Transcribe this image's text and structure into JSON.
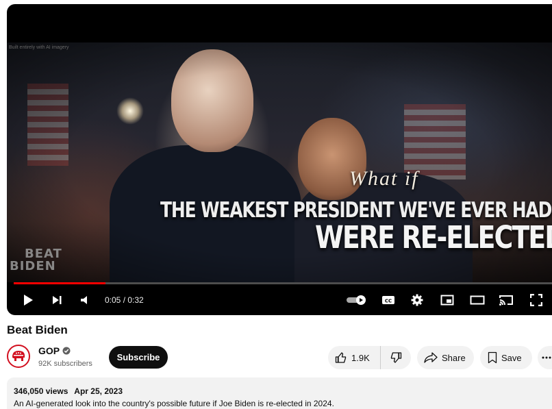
{
  "video": {
    "overlay_small": "Built entirely with AI imagery",
    "headline_small": "What if",
    "headline_line1": "THE WEAKEST PRESIDENT WE'VE EVER HAD",
    "headline_line2": "WERE RE-ELECTED",
    "logo_line1": "BEAT",
    "logo_line2": "BIDEN",
    "progress_fraction": 0.17
  },
  "controls": {
    "time": "0:05 / 0:32",
    "icons": [
      "play-icon",
      "next-icon",
      "volume-icon",
      "autoplay-toggle",
      "subtitles-icon",
      "settings-icon",
      "miniplayer-icon",
      "theater-icon",
      "cast-icon",
      "fullscreen-icon"
    ]
  },
  "info": {
    "title": "Beat Biden",
    "channel_name": "GOP",
    "subscribers": "92K subscribers",
    "subscribe_label": "Subscribe",
    "likes": "1.9K",
    "share_label": "Share",
    "save_label": "Save"
  },
  "description": {
    "views": "346,050 views",
    "date": "Apr 25, 2023",
    "text": "An AI-generated look into the country's possible future if Joe Biden is re-elected in 2024."
  },
  "colors": {
    "accent": "#ff0000",
    "gop_red": "#d20f1f"
  }
}
